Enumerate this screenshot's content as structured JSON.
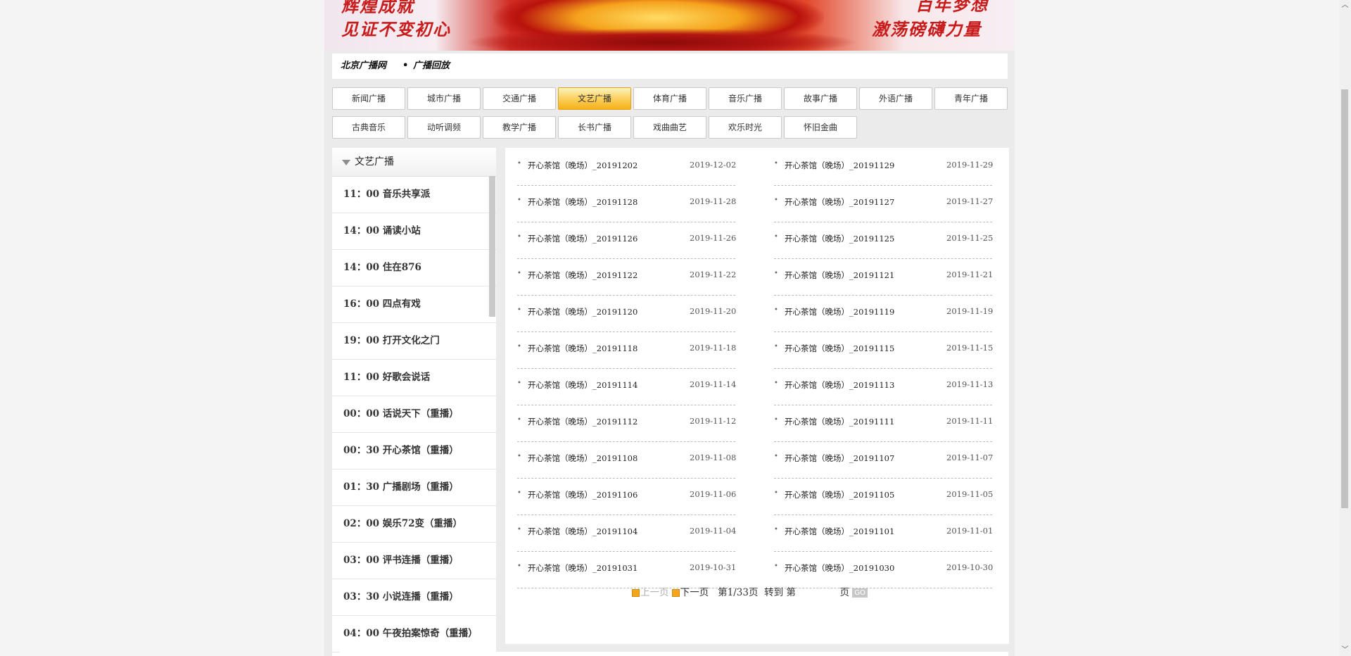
{
  "banner": {
    "slogan_left_1": "辉煌成就",
    "slogan_left_2": "见证不变初心",
    "slogan_right_1": "百年梦想",
    "slogan_right_2": "激荡磅礴力量"
  },
  "breadcrumb": {
    "home": "北京广播网",
    "separator": "•",
    "current": "广播回放"
  },
  "tabs": [
    {
      "label": "新闻广播",
      "active": false
    },
    {
      "label": "城市广播",
      "active": false
    },
    {
      "label": "交通广播",
      "active": false
    },
    {
      "label": "文艺广播",
      "active": true
    },
    {
      "label": "体育广播",
      "active": false
    },
    {
      "label": "音乐广播",
      "active": false
    },
    {
      "label": "故事广播",
      "active": false
    },
    {
      "label": "外语广播",
      "active": false
    },
    {
      "label": "青年广播",
      "active": false
    },
    {
      "label": "古典音乐",
      "active": false
    },
    {
      "label": "动听调频",
      "active": false
    },
    {
      "label": "教学广播",
      "active": false
    },
    {
      "label": "长书广播",
      "active": false
    },
    {
      "label": "戏曲曲艺",
      "active": false
    },
    {
      "label": "欢乐时光",
      "active": false
    },
    {
      "label": "怀旧金曲",
      "active": false
    }
  ],
  "schedule": {
    "title": "文艺广播",
    "items": [
      "11：00 音乐共享派",
      "14：00 诵读小站",
      "14：00 住在876",
      "16：00 四点有戏",
      "19：00 打开文化之门",
      "11：00 好歌会说话",
      "00：00 话说天下（重播）",
      "00：30 开心茶馆（重播）",
      "01：30 广播剧场（重播）",
      "02：00 娱乐72变（重播）",
      "03：00 评书连播（重播）",
      "03：30 小说连播（重播）",
      "04：00 午夜拍案惊奇（重播）"
    ]
  },
  "recordings": [
    {
      "name": "开心茶馆（晚场）_20191202",
      "date": "2019-12-02"
    },
    {
      "name": "开心茶馆（晚场）_20191129",
      "date": "2019-11-29"
    },
    {
      "name": "开心茶馆（晚场）_20191128",
      "date": "2019-11-28"
    },
    {
      "name": "开心茶馆（晚场）_20191127",
      "date": "2019-11-27"
    },
    {
      "name": "开心茶馆（晚场）_20191126",
      "date": "2019-11-26"
    },
    {
      "name": "开心茶馆（晚场）_20191125",
      "date": "2019-11-25"
    },
    {
      "name": "开心茶馆（晚场）_20191122",
      "date": "2019-11-22"
    },
    {
      "name": "开心茶馆（晚场）_20191121",
      "date": "2019-11-21"
    },
    {
      "name": "开心茶馆（晚场）_20191120",
      "date": "2019-11-20"
    },
    {
      "name": "开心茶馆（晚场）_20191119",
      "date": "2019-11-19"
    },
    {
      "name": "开心茶馆（晚场）_20191118",
      "date": "2019-11-18"
    },
    {
      "name": "开心茶馆（晚场）_20191115",
      "date": "2019-11-15"
    },
    {
      "name": "开心茶馆（晚场）_20191114",
      "date": "2019-11-14"
    },
    {
      "name": "开心茶馆（晚场）_20191113",
      "date": "2019-11-13"
    },
    {
      "name": "开心茶馆（晚场）_20191112",
      "date": "2019-11-12"
    },
    {
      "name": "开心茶馆（晚场）_20191111",
      "date": "2019-11-11"
    },
    {
      "name": "开心茶馆（晚场）_20191108",
      "date": "2019-11-08"
    },
    {
      "name": "开心茶馆（晚场）_20191107",
      "date": "2019-11-07"
    },
    {
      "name": "开心茶馆（晚场）_20191106",
      "date": "2019-11-06"
    },
    {
      "name": "开心茶馆（晚场）_20191105",
      "date": "2019-11-05"
    },
    {
      "name": "开心茶馆（晚场）_20191104",
      "date": "2019-11-04"
    },
    {
      "name": "开心茶馆（晚场）_20191101",
      "date": "2019-11-01"
    },
    {
      "name": "开心茶馆（晚场）_20191031",
      "date": "2019-10-31"
    },
    {
      "name": "开心茶馆（晚场）_20191030",
      "date": "2019-10-30"
    }
  ],
  "pagination": {
    "prev_label": "上一页",
    "next_label": "下一页",
    "page_info": "第1/33页",
    "goto_label": "转到 第",
    "page_suffix": "页",
    "go_label": "GO",
    "page_input_value": ""
  },
  "icons": {
    "pager_icon_color": "#f5a51b",
    "active_tab_color": "#f5b017"
  }
}
